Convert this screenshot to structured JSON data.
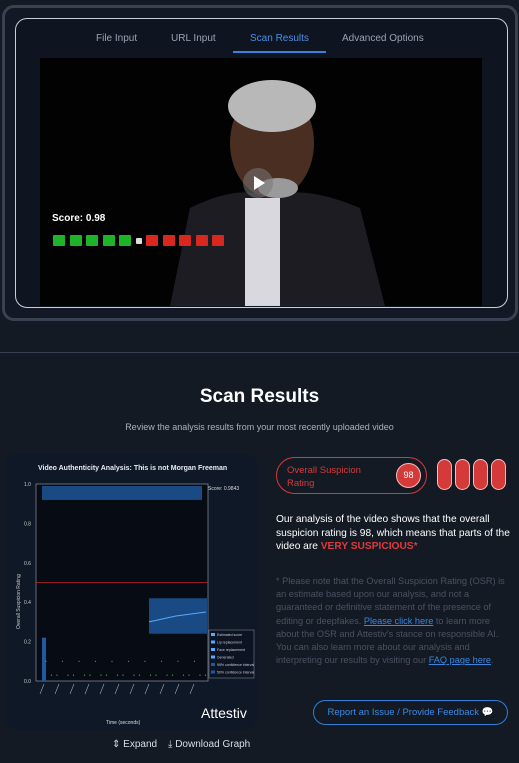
{
  "tabs": [
    {
      "label": "File Input"
    },
    {
      "label": "URL Input"
    },
    {
      "label": "Scan Results",
      "active": true
    },
    {
      "label": "Advanced Options"
    }
  ],
  "video": {
    "score_label": "Score: 0.98",
    "meter": {
      "green": 5,
      "neutral": 1,
      "red": 5
    },
    "play_icon": "play-icon"
  },
  "results": {
    "title": "Scan Results",
    "subtitle": "Review the analysis results from your most recently uploaded video"
  },
  "chart_data": {
    "type": "line",
    "title": "Video Authenticity Analysis: This is not Morgan Freeman",
    "score_box": "Score: 0.9843",
    "xlabel": "Time (seconds)",
    "ylabel": "Overall Suspicion Rating",
    "ylim": [
      0,
      1
    ],
    "yticks": [
      "0.0",
      "0.2",
      "0.4",
      "0.6",
      "0.8",
      "1.0"
    ],
    "threshold": 0.5,
    "legend": [
      "Estimated score",
      "Lip replacement",
      "Face replacement",
      "Generated",
      "95% confidence interval",
      "50% confidence interval"
    ],
    "legend_position": "bottom-right",
    "brand": "Attestiv"
  },
  "chart_tools": {
    "expand": "Expand",
    "download": "Download Graph"
  },
  "rating": {
    "label": "Overall Suspicion Rating",
    "value": "98",
    "color": "#d43a3a"
  },
  "summary": {
    "text": "Our analysis of the video shows that the overall suspicion rating is 98, which means that parts of the video are ",
    "verdict": "VERY SUSPICIOUS*"
  },
  "note": {
    "part1": "* Please note that the Overall Suspicion Rating (OSR) is an estimate based upon our analysis, and not a guaranteed or definitive statement of the presence of editing or deepfakes. ",
    "link1": "Please click here",
    "part2": " to learn more about the OSR and Attestiv's stance on responsible AI. You can also learn more about our analysis and interpreting our results by visiting our ",
    "link2": "FAQ page here",
    "part3": "."
  },
  "feedback_button": "Report an Issue / Provide Feedback"
}
